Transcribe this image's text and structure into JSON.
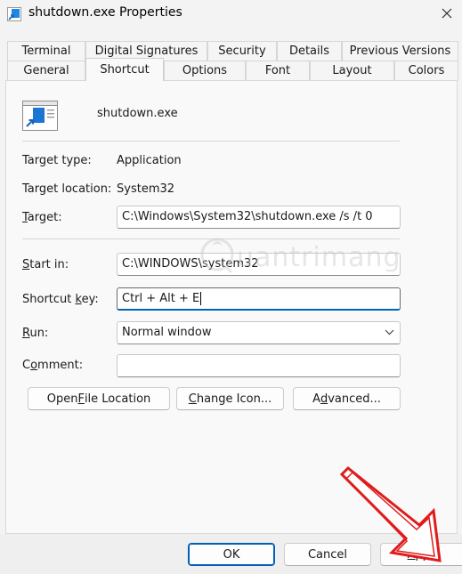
{
  "window": {
    "title": "shutdown.exe Properties",
    "icons": {
      "app": "shortcut-icon",
      "close": "close-icon"
    }
  },
  "tabs": {
    "row1": [
      "Terminal",
      "Digital Signatures",
      "Security",
      "Details",
      "Previous Versions"
    ],
    "row2": [
      "General",
      "Shortcut",
      "Options",
      "Font",
      "Layout",
      "Colors"
    ],
    "active": "Shortcut"
  },
  "shortcut": {
    "filename": "shutdown.exe",
    "target_type_label": "Target type:",
    "target_type_value": "Application",
    "target_location_label": "Target location:",
    "target_location_value": "System32",
    "target_label_pre": "",
    "target_label_key": "T",
    "target_label_post": "arget:",
    "target_value": "C:\\Windows\\System32\\shutdown.exe /s /t 0",
    "start_in_label_pre": "",
    "start_in_label_key": "S",
    "start_in_label_post": "tart in:",
    "start_in_value": "C:\\WINDOWS\\system32",
    "shortcut_key_label_pre": "Shortcut ",
    "shortcut_key_label_key": "k",
    "shortcut_key_label_post": "ey:",
    "shortcut_key_value": "Ctrl + Alt + E",
    "run_label_pre": "",
    "run_label_key": "R",
    "run_label_post": "un:",
    "run_value": "Normal window",
    "comment_label_pre": "C",
    "comment_label_key": "o",
    "comment_label_post": "mment:",
    "comment_value": ""
  },
  "buttons": {
    "open_file_location_pre": "Open ",
    "open_file_location_key": "F",
    "open_file_location_post": "ile Location",
    "change_icon_pre": "",
    "change_icon_key": "C",
    "change_icon_post": "hange Icon...",
    "advanced_pre": "A",
    "advanced_key": "d",
    "advanced_post": "vanced...",
    "ok": "OK",
    "cancel": "Cancel",
    "apply_pre": "",
    "apply_key": "A",
    "apply_post": "pply"
  },
  "watermark": {
    "text": "uantrimang"
  },
  "colors": {
    "accent": "#005fb8",
    "annotation": "#e01b1b"
  }
}
